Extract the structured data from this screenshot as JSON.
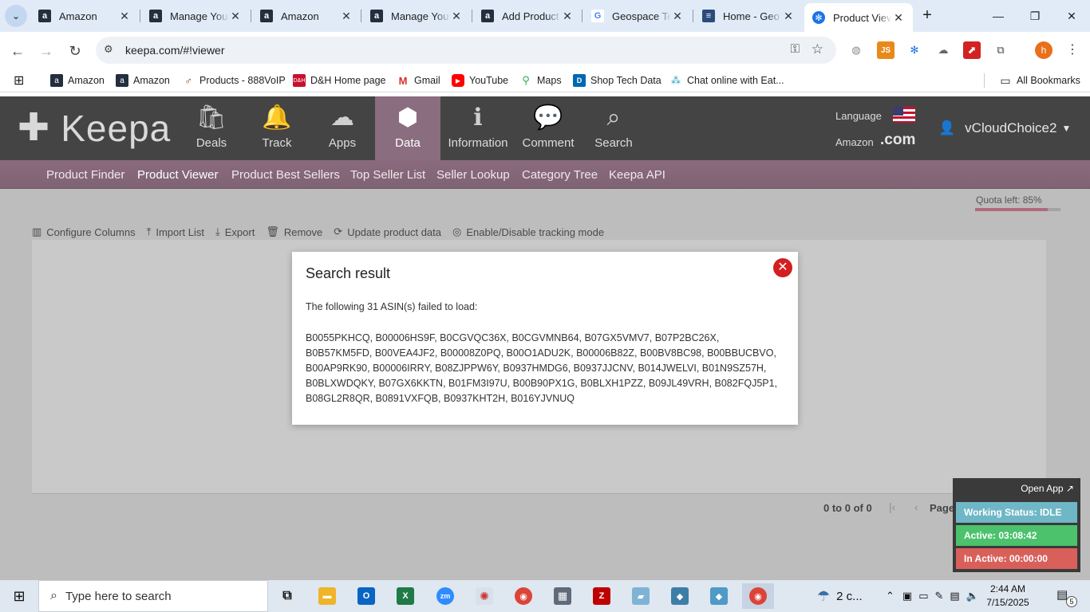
{
  "browser": {
    "tabs": [
      {
        "title": "Amazon",
        "icon": "amazon-icon"
      },
      {
        "title": "Manage Your",
        "icon": "amazon-icon"
      },
      {
        "title": "Amazon",
        "icon": "amazon-icon"
      },
      {
        "title": "Manage Your",
        "icon": "amazon-icon"
      },
      {
        "title": "Add Product",
        "icon": "amazon-icon"
      },
      {
        "title": "Geospace Te",
        "icon": "google-icon"
      },
      {
        "title": "Home - Geo",
        "icon": "geospace-icon"
      },
      {
        "title": "Product Viev",
        "icon": "keepa-icon",
        "active": true
      }
    ],
    "url": "keepa.com/#!viewer",
    "profile_initial": "h",
    "bookmarks": [
      {
        "label": "Amazon"
      },
      {
        "label": "Amazon"
      },
      {
        "label": "Products - 888VoIP"
      },
      {
        "label": "D&H Home page"
      },
      {
        "label": "Gmail"
      },
      {
        "label": "YouTube"
      },
      {
        "label": "Maps"
      },
      {
        "label": "Shop Tech Data"
      },
      {
        "label": "Chat online with Eat..."
      }
    ],
    "all_bookmarks": "All Bookmarks"
  },
  "keepa": {
    "logo": "Keepa",
    "nav": [
      {
        "label": "Deals",
        "icon": "bag-icon"
      },
      {
        "label": "Track",
        "icon": "bell-icon"
      },
      {
        "label": "Apps",
        "icon": "cloud-download-icon"
      },
      {
        "label": "Data",
        "icon": "box-icon",
        "active": true
      },
      {
        "label": "Information",
        "icon": "info-icon"
      },
      {
        "label": "Comment",
        "icon": "comment-icon"
      },
      {
        "label": "Search",
        "icon": "search-icon"
      }
    ],
    "language_label": "Language",
    "amazon_label": "Amazon",
    "domain": ".com",
    "username": "vCloudChoice2",
    "subnav": [
      {
        "label": "Product Finder"
      },
      {
        "label": "Product Viewer",
        "active": true
      },
      {
        "label": "Product Best Sellers"
      },
      {
        "label": "Top Seller List"
      },
      {
        "label": "Seller Lookup"
      },
      {
        "label": "Category Tree"
      },
      {
        "label": "Keepa API"
      }
    ],
    "quota_text": "Quota left: 85%",
    "quota_fraction": 0.85,
    "toolbar": {
      "configure": "Configure Columns",
      "import": "Import List",
      "export": "Export",
      "remove": "Remove",
      "update": "Update product data",
      "tracking": "Enable/Disable tracking mode"
    },
    "pager_count": "0 to 0 of 0",
    "pager_page": "Page 0 of 0"
  },
  "modal": {
    "title": "Search result",
    "message": "The following 31 ASIN(s) failed to load:",
    "asins": "B0055PKHCQ, B00006HS9F, B0CGVQC36X, B0CGVMNB64, B07GX5VMV7, B07P2BC26X, B0B57KM5FD, B00VEA4JF2, B00008Z0PQ, B00O1ADU2K, B00006B82Z, B00BV8BC98, B00BBUCBVO, B00AP9RK90, B00006IRRY, B08ZJPPW6Y, B0937HMDG6, B0937JJCNV, B014JWELVI, B01N9SZ57H, B0BLXWDQKY, B07GX6KKTN, B01FM3I97U, B00B90PX1G, B0BLXH1PZZ, B09JL49VRH, B082FQJ5P1, B08GL2R8QR, B0891VXFQB, B0937KHT2H, B016YJVNUQ"
  },
  "status_widget": {
    "open_app": "Open App ↗",
    "working": "Working Status: IDLE",
    "active": "Active: 03:08:42",
    "inactive": "In Active: 00:00:00"
  },
  "taskbar": {
    "search_placeholder": "Type here to search",
    "weather": "2 c...",
    "time": "2:44 AM",
    "date": "7/15/2025",
    "notif_count": "5"
  },
  "colors": {
    "header_bg": "#444444",
    "subnav_bg": "#8a6b7d",
    "active_nav": "#8a6d7e",
    "close_red": "#d21f1f",
    "status_idle": "#6fb7c6",
    "status_active": "#4cc26d",
    "status_inactive": "#d9605a"
  }
}
